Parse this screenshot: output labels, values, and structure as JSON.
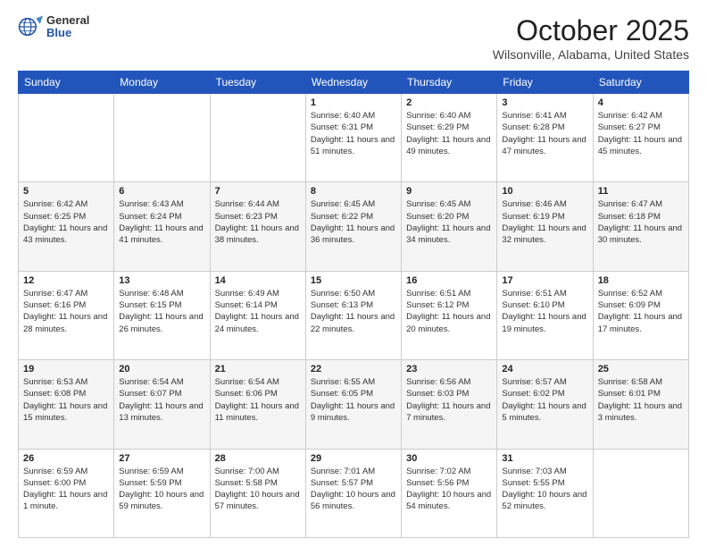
{
  "header": {
    "logo": {
      "general": "General",
      "blue": "Blue"
    },
    "title": "October 2025",
    "location": "Wilsonville, Alabama, United States"
  },
  "days_of_week": [
    "Sunday",
    "Monday",
    "Tuesday",
    "Wednesday",
    "Thursday",
    "Friday",
    "Saturday"
  ],
  "weeks": [
    [
      {
        "day": "",
        "info": ""
      },
      {
        "day": "",
        "info": ""
      },
      {
        "day": "",
        "info": ""
      },
      {
        "day": "1",
        "sunrise": "6:40 AM",
        "sunset": "6:31 PM",
        "daylight": "11 hours and 51 minutes."
      },
      {
        "day": "2",
        "sunrise": "6:40 AM",
        "sunset": "6:29 PM",
        "daylight": "11 hours and 49 minutes."
      },
      {
        "day": "3",
        "sunrise": "6:41 AM",
        "sunset": "6:28 PM",
        "daylight": "11 hours and 47 minutes."
      },
      {
        "day": "4",
        "sunrise": "6:42 AM",
        "sunset": "6:27 PM",
        "daylight": "11 hours and 45 minutes."
      }
    ],
    [
      {
        "day": "5",
        "sunrise": "6:42 AM",
        "sunset": "6:25 PM",
        "daylight": "11 hours and 43 minutes."
      },
      {
        "day": "6",
        "sunrise": "6:43 AM",
        "sunset": "6:24 PM",
        "daylight": "11 hours and 41 minutes."
      },
      {
        "day": "7",
        "sunrise": "6:44 AM",
        "sunset": "6:23 PM",
        "daylight": "11 hours and 38 minutes."
      },
      {
        "day": "8",
        "sunrise": "6:45 AM",
        "sunset": "6:22 PM",
        "daylight": "11 hours and 36 minutes."
      },
      {
        "day": "9",
        "sunrise": "6:45 AM",
        "sunset": "6:20 PM",
        "daylight": "11 hours and 34 minutes."
      },
      {
        "day": "10",
        "sunrise": "6:46 AM",
        "sunset": "6:19 PM",
        "daylight": "11 hours and 32 minutes."
      },
      {
        "day": "11",
        "sunrise": "6:47 AM",
        "sunset": "6:18 PM",
        "daylight": "11 hours and 30 minutes."
      }
    ],
    [
      {
        "day": "12",
        "sunrise": "6:47 AM",
        "sunset": "6:16 PM",
        "daylight": "11 hours and 28 minutes."
      },
      {
        "day": "13",
        "sunrise": "6:48 AM",
        "sunset": "6:15 PM",
        "daylight": "11 hours and 26 minutes."
      },
      {
        "day": "14",
        "sunrise": "6:49 AM",
        "sunset": "6:14 PM",
        "daylight": "11 hours and 24 minutes."
      },
      {
        "day": "15",
        "sunrise": "6:50 AM",
        "sunset": "6:13 PM",
        "daylight": "11 hours and 22 minutes."
      },
      {
        "day": "16",
        "sunrise": "6:51 AM",
        "sunset": "6:12 PM",
        "daylight": "11 hours and 20 minutes."
      },
      {
        "day": "17",
        "sunrise": "6:51 AM",
        "sunset": "6:10 PM",
        "daylight": "11 hours and 19 minutes."
      },
      {
        "day": "18",
        "sunrise": "6:52 AM",
        "sunset": "6:09 PM",
        "daylight": "11 hours and 17 minutes."
      }
    ],
    [
      {
        "day": "19",
        "sunrise": "6:53 AM",
        "sunset": "6:08 PM",
        "daylight": "11 hours and 15 minutes."
      },
      {
        "day": "20",
        "sunrise": "6:54 AM",
        "sunset": "6:07 PM",
        "daylight": "11 hours and 13 minutes."
      },
      {
        "day": "21",
        "sunrise": "6:54 AM",
        "sunset": "6:06 PM",
        "daylight": "11 hours and 11 minutes."
      },
      {
        "day": "22",
        "sunrise": "6:55 AM",
        "sunset": "6:05 PM",
        "daylight": "11 hours and 9 minutes."
      },
      {
        "day": "23",
        "sunrise": "6:56 AM",
        "sunset": "6:03 PM",
        "daylight": "11 hours and 7 minutes."
      },
      {
        "day": "24",
        "sunrise": "6:57 AM",
        "sunset": "6:02 PM",
        "daylight": "11 hours and 5 minutes."
      },
      {
        "day": "25",
        "sunrise": "6:58 AM",
        "sunset": "6:01 PM",
        "daylight": "11 hours and 3 minutes."
      }
    ],
    [
      {
        "day": "26",
        "sunrise": "6:59 AM",
        "sunset": "6:00 PM",
        "daylight": "11 hours and 1 minute."
      },
      {
        "day": "27",
        "sunrise": "6:59 AM",
        "sunset": "5:59 PM",
        "daylight": "10 hours and 59 minutes."
      },
      {
        "day": "28",
        "sunrise": "7:00 AM",
        "sunset": "5:58 PM",
        "daylight": "10 hours and 57 minutes."
      },
      {
        "day": "29",
        "sunrise": "7:01 AM",
        "sunset": "5:57 PM",
        "daylight": "10 hours and 56 minutes."
      },
      {
        "day": "30",
        "sunrise": "7:02 AM",
        "sunset": "5:56 PM",
        "daylight": "10 hours and 54 minutes."
      },
      {
        "day": "31",
        "sunrise": "7:03 AM",
        "sunset": "5:55 PM",
        "daylight": "10 hours and 52 minutes."
      },
      {
        "day": "",
        "info": ""
      }
    ]
  ],
  "labels": {
    "sunrise": "Sunrise:",
    "sunset": "Sunset:",
    "daylight": "Daylight:"
  }
}
